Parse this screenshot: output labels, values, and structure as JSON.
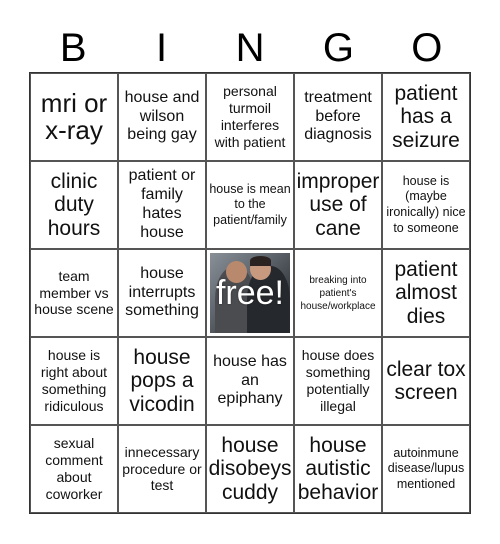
{
  "title_letters": [
    "B",
    "I",
    "N",
    "G",
    "O"
  ],
  "cells": [
    {
      "text": "mri or x-ray",
      "size": "xl"
    },
    {
      "text": "house and wilson being gay",
      "size": "m"
    },
    {
      "text": "personal turmoil interferes with patient",
      "size": "sm"
    },
    {
      "text": "treatment before diagnosis",
      "size": "m"
    },
    {
      "text": "patient has a seizure",
      "size": "l"
    },
    {
      "text": "clinic duty hours",
      "size": "l"
    },
    {
      "text": "patient or family hates house",
      "size": "m"
    },
    {
      "text": "house is mean to the patient/family",
      "size": "s"
    },
    {
      "text": "improper use of cane",
      "size": "l"
    },
    {
      "text": "house is (maybe ironically) nice to someone",
      "size": "s"
    },
    {
      "text": "team member vs house scene",
      "size": "sm"
    },
    {
      "text": "house interrupts something",
      "size": "m"
    },
    {
      "text": "free!",
      "size": "free",
      "image": "house-and-wilson-photo"
    },
    {
      "text": "breaking into patient's house/workplace",
      "size": "xs"
    },
    {
      "text": "patient almost dies",
      "size": "l"
    },
    {
      "text": "house is right about something ridiculous",
      "size": "sm"
    },
    {
      "text": "house pops a vicodin",
      "size": "l"
    },
    {
      "text": "house has an epiphany",
      "size": "m"
    },
    {
      "text": "house does something potentially illegal",
      "size": "sm"
    },
    {
      "text": "clear tox screen",
      "size": "l"
    },
    {
      "text": "sexual comment about coworker",
      "size": "sm"
    },
    {
      "text": "innecessary procedure or test",
      "size": "sm"
    },
    {
      "text": "house disobeys cuddy",
      "size": "l"
    },
    {
      "text": "house autistic behavior",
      "size": "l"
    },
    {
      "text": "autoinmune disease/lupus mentioned",
      "size": "s"
    }
  ]
}
